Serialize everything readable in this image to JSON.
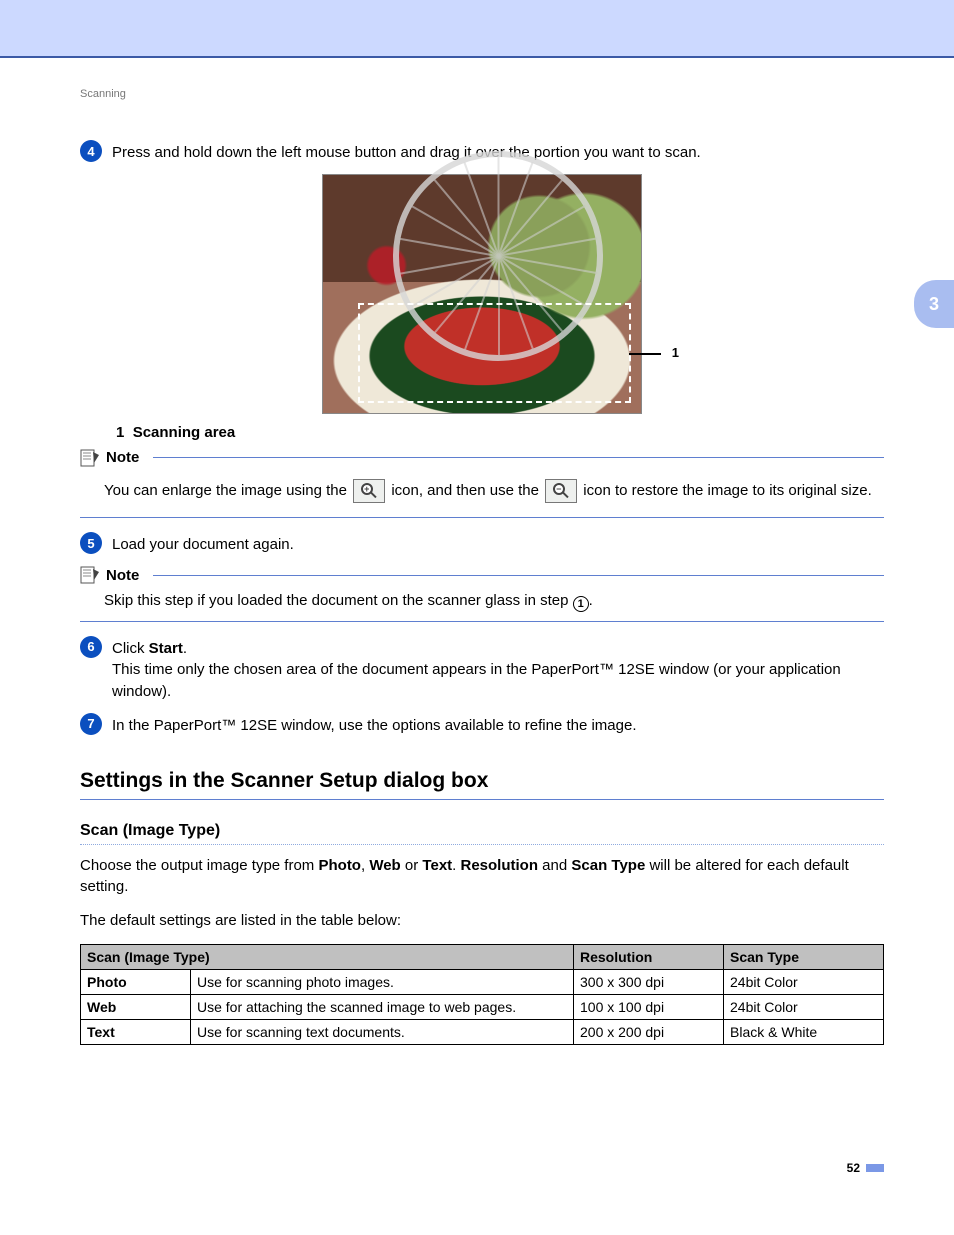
{
  "breadcrumb": "Scanning",
  "sidebar_tab": "3",
  "steps": {
    "s4": {
      "num": "4",
      "text": "Press and hold down the left mouse button and drag it over the portion you want to scan."
    },
    "s5": {
      "num": "5",
      "text": "Load your document again."
    },
    "s6": {
      "num": "6",
      "lead": "Click ",
      "bold": "Start",
      "dot": ".",
      "follow": "This time only the chosen area of the document appears in the PaperPort™ 12SE window (or your application window)."
    },
    "s7": {
      "num": "7",
      "text": "In the PaperPort™ 12SE window, use the options available to refine the image."
    }
  },
  "figure": {
    "callout_num": "1",
    "caption_num": "1",
    "caption_label": "Scanning area"
  },
  "note1": {
    "label": "Note",
    "part1": "You can enlarge the image using the ",
    "part2": " icon, and then use the ",
    "part3": " icon to restore the image to its original size."
  },
  "note2": {
    "label": "Note",
    "part1": "Skip this step if you loaded the document on the scanner glass in step ",
    "ref": "1",
    "dot": "."
  },
  "section_title": "Settings in the Scanner Setup dialog box",
  "subsection_title": "Scan (Image Type)",
  "para1": {
    "a": "Choose the output image type from ",
    "b": "Photo",
    "c": ", ",
    "d": "Web",
    "e": " or ",
    "f": "Text",
    "g": ". ",
    "h": "Resolution",
    "i": " and ",
    "j": "Scan Type",
    "k": " will be altered for each default setting."
  },
  "para2": "The default settings are listed in the table below:",
  "table": {
    "headers": {
      "c1": "Scan (Image Type)",
      "c2": "Resolution",
      "c3": "Scan Type"
    },
    "rows": [
      {
        "type": "Photo",
        "desc": "Use for scanning photo images.",
        "res": "300 x 300 dpi",
        "scan": "24bit Color"
      },
      {
        "type": "Web",
        "desc": "Use for attaching the scanned image to web pages.",
        "res": "100 x 100 dpi",
        "scan": "24bit Color"
      },
      {
        "type": "Text",
        "desc": "Use for scanning text documents.",
        "res": "200 x 200 dpi",
        "scan": "Black & White"
      }
    ]
  },
  "page_number": "52"
}
